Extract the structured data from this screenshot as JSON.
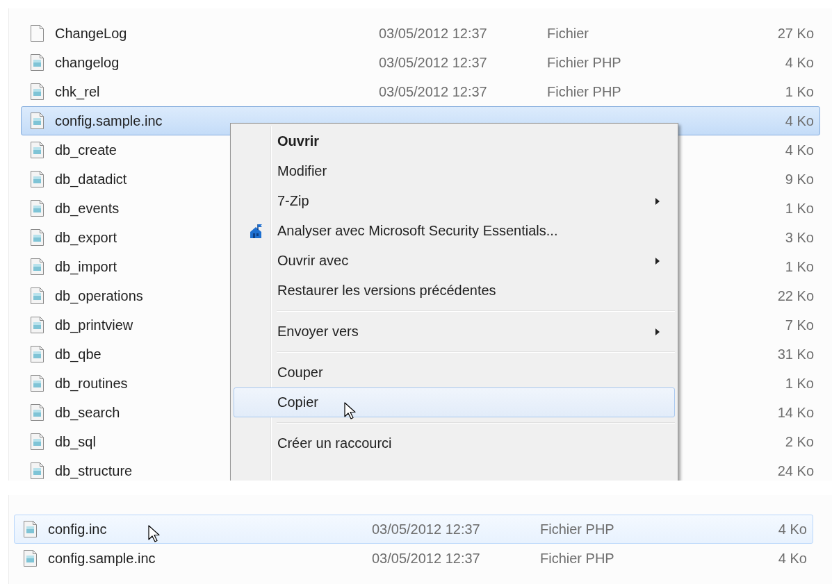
{
  "top_list": {
    "rows": [
      {
        "kind": "plain",
        "name": "ChangeLog",
        "date": "03/05/2012 12:37",
        "type": "Fichier",
        "size": "27 Ko",
        "selected": false,
        "hot": false
      },
      {
        "kind": "php",
        "name": "changelog",
        "date": "03/05/2012 12:37",
        "type": "Fichier PHP",
        "size": "4 Ko",
        "selected": false,
        "hot": false
      },
      {
        "kind": "php",
        "name": "chk_rel",
        "date": "03/05/2012 12:37",
        "type": "Fichier PHP",
        "size": "1 Ko",
        "selected": false,
        "hot": false
      },
      {
        "kind": "php",
        "name": "config.sample.inc",
        "size": "4 Ko",
        "selected": true,
        "hot": false
      },
      {
        "kind": "php",
        "name": "db_create",
        "size": "4 Ko",
        "selected": false,
        "hot": false
      },
      {
        "kind": "php",
        "name": "db_datadict",
        "size": "9 Ko",
        "selected": false,
        "hot": false
      },
      {
        "kind": "php",
        "name": "db_events",
        "size": "1 Ko",
        "selected": false,
        "hot": false
      },
      {
        "kind": "php",
        "name": "db_export",
        "size": "3 Ko",
        "selected": false,
        "hot": false
      },
      {
        "kind": "php",
        "name": "db_import",
        "size": "1 Ko",
        "selected": false,
        "hot": false
      },
      {
        "kind": "php",
        "name": "db_operations",
        "size": "22 Ko",
        "selected": false,
        "hot": false
      },
      {
        "kind": "php",
        "name": "db_printview",
        "size": "7 Ko",
        "selected": false,
        "hot": false
      },
      {
        "kind": "php",
        "name": "db_qbe",
        "size": "31 Ko",
        "selected": false,
        "hot": false
      },
      {
        "kind": "php",
        "name": "db_routines",
        "size": "1 Ko",
        "selected": false,
        "hot": false
      },
      {
        "kind": "php",
        "name": "db_search",
        "size": "14 Ko",
        "selected": false,
        "hot": false
      },
      {
        "kind": "php",
        "name": "db_sql",
        "size": "2 Ko",
        "selected": false,
        "hot": false
      },
      {
        "kind": "php",
        "name": "db_structure",
        "size": "24 Ko",
        "selected": false,
        "hot": false
      }
    ]
  },
  "context_menu": {
    "items": [
      {
        "kind": "item",
        "label": "Ouvrir",
        "default": true,
        "submenu": false,
        "selected": false
      },
      {
        "kind": "item",
        "label": "Modifier",
        "default": false,
        "submenu": false,
        "selected": false
      },
      {
        "kind": "item",
        "label": "7-Zip",
        "default": false,
        "submenu": true,
        "selected": false
      },
      {
        "kind": "icon-item",
        "label": "Analyser avec Microsoft Security Essentials...",
        "default": false,
        "submenu": false,
        "selected": false
      },
      {
        "kind": "item",
        "label": "Ouvrir avec",
        "default": false,
        "submenu": true,
        "selected": false
      },
      {
        "kind": "item",
        "label": "Restaurer les versions précédentes",
        "default": false,
        "submenu": false,
        "selected": false
      },
      {
        "kind": "separator"
      },
      {
        "kind": "item",
        "label": "Envoyer vers",
        "default": false,
        "submenu": true,
        "selected": false
      },
      {
        "kind": "separator"
      },
      {
        "kind": "item",
        "label": "Couper",
        "default": false,
        "submenu": false,
        "selected": false
      },
      {
        "kind": "item",
        "label": "Copier",
        "default": false,
        "submenu": false,
        "selected": true
      },
      {
        "kind": "separator"
      },
      {
        "kind": "item",
        "label": "Créer un raccourci",
        "default": false,
        "submenu": false,
        "selected": false
      }
    ]
  },
  "bottom_list": {
    "rows": [
      {
        "kind": "php",
        "name": "config.inc",
        "date": "03/05/2012 12:37",
        "type": "Fichier PHP",
        "size": "4 Ko",
        "selected": false,
        "hot": true
      },
      {
        "kind": "php",
        "name": "config.sample.inc",
        "date": "03/05/2012 12:37",
        "type": "Fichier PHP",
        "size": "4 Ko",
        "selected": false,
        "hot": false
      }
    ]
  }
}
